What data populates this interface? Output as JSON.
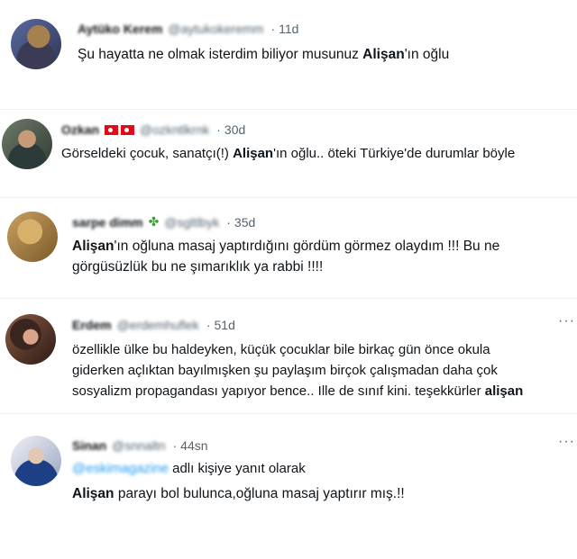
{
  "tweets": [
    {
      "name": "Aytüko Kerem",
      "handle": "@aytukokeremm",
      "time": "11d",
      "text": [
        "Şu hayatta ne olmak isterdim biliyor musunuz ",
        "Alişan",
        "'ın oğlu"
      ]
    },
    {
      "name": "Ozkan",
      "handle": "@ozkntlkrnk",
      "time": "30d",
      "text": [
        "Görseldeki çocuk, sanatçı(!) ",
        "Alişan",
        "'ın oğlu.. öteki Türkiye'de durumlar böyle"
      ]
    },
    {
      "name": "sarpe dimm",
      "handle": "@sgltlbyk",
      "time": "35d",
      "line1": [
        "Alişan",
        "'ın oğluna masaj yaptırdığını gördüm görmez olaydım !!! Bu ne"
      ],
      "line2": "görgüsüzlük bu ne şımarıklık ya rabbi  !!!!"
    },
    {
      "name": "Erdem",
      "handle": "@erdemhuflek",
      "time": "51d",
      "line1": "özellikle ülke bu haldeyken, küçük çocuklar bile birkaç gün önce okula",
      "line2": "giderken açlıktan bayılmışken şu paylaşım birçok çalışmadan daha çok",
      "line3": [
        "sosyalizm propagandası yapıyor bence.. Ille de sınıf kini. teşekkürler ",
        "alişan"
      ]
    },
    {
      "name": "Sinan",
      "handle": "@snnaltn",
      "time": "44sn",
      "reply_handle": "@eskimagazine",
      "reply_suffix": " adlı kişiye yanıt olarak",
      "text": [
        "Alişan",
        " parayı bol bulunca,oğluna masaj yaptırır mış.!!"
      ]
    }
  ],
  "more_label": "···"
}
